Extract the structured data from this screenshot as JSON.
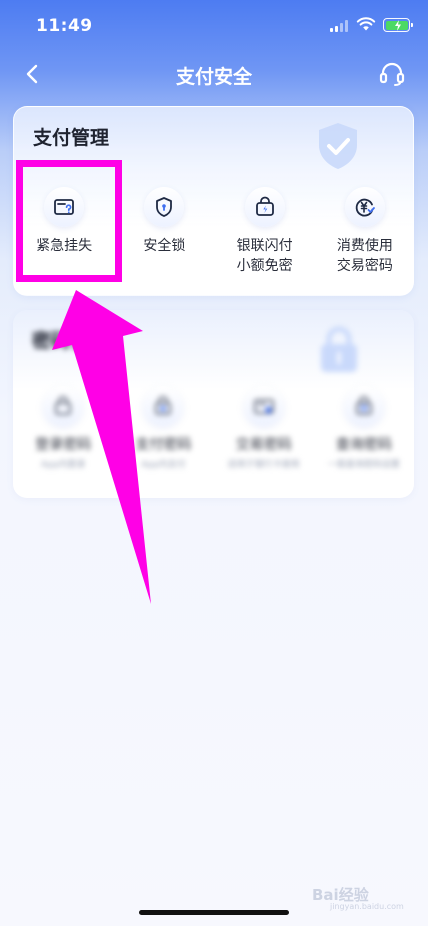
{
  "status_bar": {
    "time": "11:49"
  },
  "nav": {
    "title": "支付安全"
  },
  "payment_management": {
    "title": "支付管理",
    "items": [
      {
        "label": "紧急挂失",
        "icon": "card-lost-icon"
      },
      {
        "label": "安全锁",
        "icon": "shield-icon"
      },
      {
        "label": "银联闪付\n小额免密",
        "icon": "flash-pay-icon"
      },
      {
        "label": "消费使用\n交易密码",
        "icon": "yuan-check-icon"
      }
    ]
  },
  "password_management": {
    "title": "密码管理",
    "items": [
      {
        "label": "登录密码",
        "sub": "App内登录"
      },
      {
        "label": "支付密码",
        "sub": "App内支付"
      },
      {
        "label": "交易密码",
        "sub": "适用于银行卡使用"
      },
      {
        "label": "查询密码",
        "sub": "一般查询密码设置"
      }
    ]
  },
  "watermark": {
    "brand": "Bai经验",
    "url": "jingyan.baidu.com"
  },
  "colors": {
    "accent": "#3f6ff0",
    "highlight": "#ff00e6",
    "header": "#4d7cf2"
  }
}
